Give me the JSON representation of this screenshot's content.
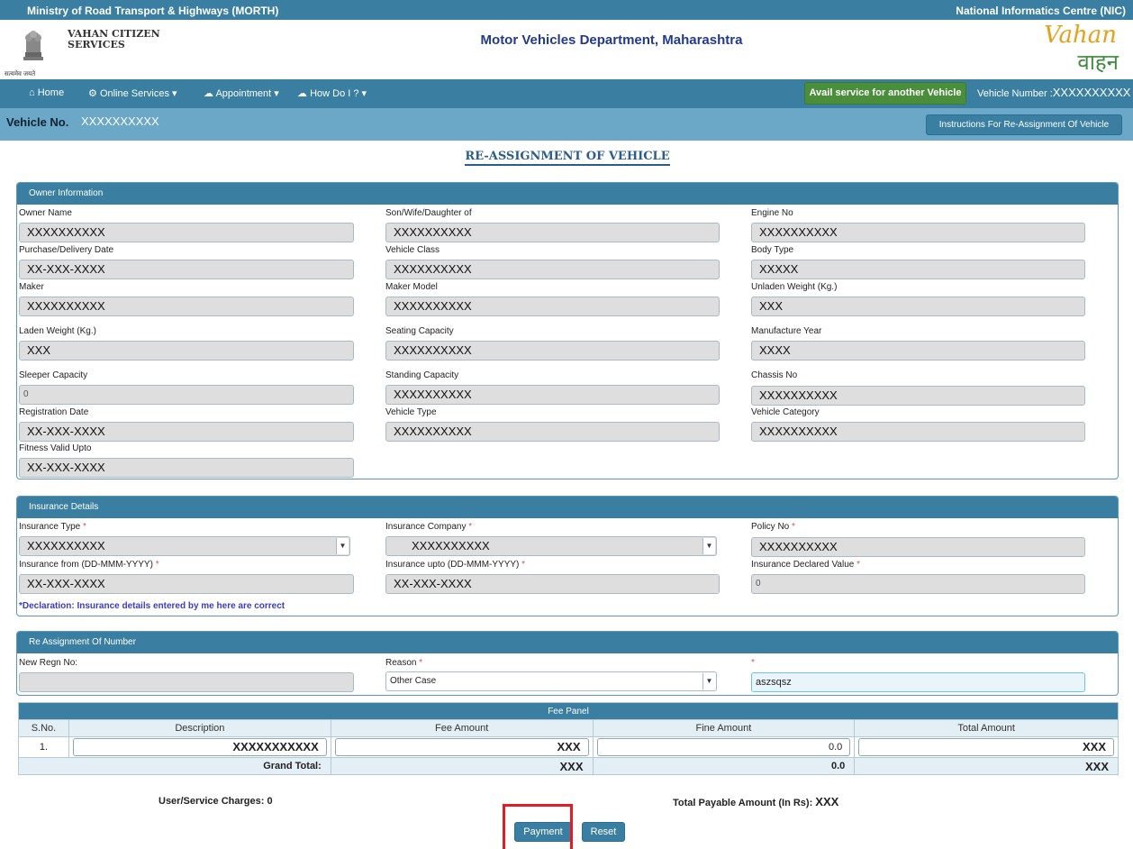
{
  "header": {
    "ministry": "Ministry of Road Transport & Highways (MORTH)",
    "nic": "National Informatics Centre (NIC)",
    "brand_line1": "VAHAN CITIZEN",
    "brand_line2": "SERVICES",
    "motto": "सत्यमेव जयते",
    "department": "Motor Vehicles Department, Maharashtra",
    "logo_en": "Vahan",
    "logo_hi": "वाहन"
  },
  "nav": {
    "home": "Home",
    "online_services": "Online Services",
    "appointment": "Appointment",
    "how_do_i": "How Do I ?",
    "avail": "Avail service for another Vehicle",
    "vehicle_number_label": "Vehicle Number :",
    "vehicle_number_value": "XXXXXXXXXX"
  },
  "vehicle_bar": {
    "label": "Vehicle No.",
    "value": "XXXXXXXXXX",
    "instructions": "Instructions For Re-Assignment Of Vehicle"
  },
  "page_title": "RE-ASSIGNMENT OF VEHICLE",
  "owner": {
    "title": "Owner Information",
    "owner_name_l": "Owner Name",
    "owner_name": "XXXXXXXXXX",
    "swd_l": "Son/Wife/Daughter of",
    "swd": "XXXXXXXXXX",
    "engine_l": "Engine No",
    "engine": "XXXXXXXXXX",
    "purchase_l": "Purchase/Delivery Date",
    "purchase": "XX-XXX-XXXX",
    "vclass_l": "Vehicle Class",
    "vclass": "XXXXXXXXXX",
    "body_l": "Body Type",
    "body": "XXXXX",
    "maker_l": "Maker",
    "maker": "XXXXXXXXXX",
    "model_l": "Maker Model",
    "model": "XXXXXXXXXX",
    "unladen_l": "Unladen Weight (Kg.)",
    "unladen": "XXX",
    "laden_l": "Laden Weight (Kg.)",
    "laden": "XXX",
    "seating_l": "Seating Capacity",
    "seating": "XXXXXXXXXX",
    "mfg_l": "Manufacture Year",
    "mfg": "XXXX",
    "sleeper_l": "Sleeper Capacity",
    "sleeper": "0",
    "standing_l": "Standing Capacity",
    "standing": "XXXXXXXXXX",
    "chassis_l": "Chassis No",
    "chassis": "XXXXXXXXXX",
    "regdate_l": "Registration Date",
    "regdate": "XX-XXX-XXXX",
    "vtype_l": "Vehicle Type",
    "vtype": "XXXXXXXXXX",
    "vcat_l": "Vehicle Category",
    "vcat": "XXXXXXXXXX",
    "fitness_l": "Fitness Valid Upto",
    "fitness": "XX-XXX-XXXX"
  },
  "insurance": {
    "title": "Insurance Details",
    "type_l": "Insurance Type",
    "type": "XXXXXXXXXX",
    "company_l": "Insurance Company",
    "company": "XXXXXXXXXX",
    "policy_l": "Policy No",
    "policy": "XXXXXXXXXX",
    "from_l": "Insurance from (DD-MMM-YYYY)",
    "from": "XX-XXX-XXXX",
    "upto_l": "Insurance upto (DD-MMM-YYYY)",
    "upto": "XX-XXX-XXXX",
    "idv_l": "Insurance Declared Value",
    "idv": "0",
    "required_mark": "*",
    "declaration": "*Declaration: Insurance details entered by me here are correct"
  },
  "reassign": {
    "title": "Re Assignment Of Number",
    "new_regn_l": "New Regn No:",
    "new_regn": "",
    "reason_l": "Reason",
    "reason": "Other Case",
    "other_l": "",
    "other": "aszsqsz"
  },
  "fee": {
    "title": "Fee Panel",
    "headers": [
      "S.No.",
      "Description",
      "Fee Amount",
      "Fine Amount",
      "Total Amount"
    ],
    "row": {
      "sno": "1.",
      "desc": "XXXXXXXXXXX",
      "fee": "XXX",
      "fine": "0.0",
      "total": "XXX"
    },
    "grand_label": "Grand Total:",
    "grand_fee": "XXX",
    "grand_fine": "0.0",
    "grand_total": "XXX"
  },
  "summary": {
    "user_charges": "User/Service Charges: 0",
    "payable_label": "Total Payable Amount (In Rs):",
    "payable_value": "XXX"
  },
  "buttons": {
    "payment": "Payment",
    "reset": "Reset"
  }
}
